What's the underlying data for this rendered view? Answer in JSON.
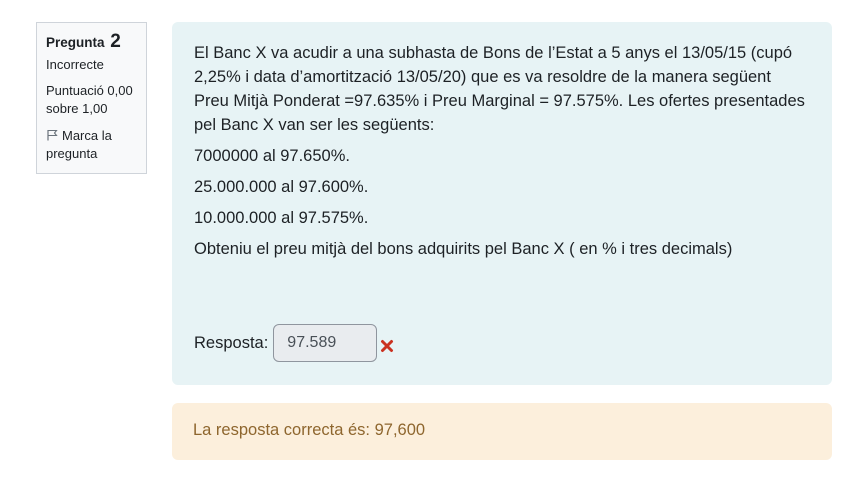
{
  "question_info": {
    "label": "Pregunta",
    "number": "2",
    "state": "Incorrecte",
    "grade": "Puntuació 0,00 sobre 1,00",
    "flag_label": "Marca la pregunta"
  },
  "question": {
    "paragraphs": [
      "El Banc X va acudir a una subhasta de Bons de l’Estat a 5 anys el 13/05/15 (cupó 2,25% i data d’amortització 13/05/20) que es va resoldre de la manera següent Preu Mitjà Ponderat =97.635% i Preu Marginal = 97.575%. Les ofertes presentades pel Banc X van ser les següents:",
      "7000000 al 97.650%.",
      "25.000.000 al 97.600%.",
      "10.000.000 al 97.575%.",
      "Obteniu el preu mitjà del bons adquirits pel Banc X ( en % i tres decimals)"
    ],
    "answer_label": "Resposta:",
    "answer_value": "97.589",
    "answer_icon": "incorrect-cross-icon"
  },
  "feedback": {
    "correct_answer": "La resposta correcta és: 97,600"
  },
  "colors": {
    "content_bg": "#e7f3f5",
    "feedback_bg": "#fcefdc",
    "feedback_text": "#8e662e",
    "incorrect_icon": "#ca3120"
  }
}
